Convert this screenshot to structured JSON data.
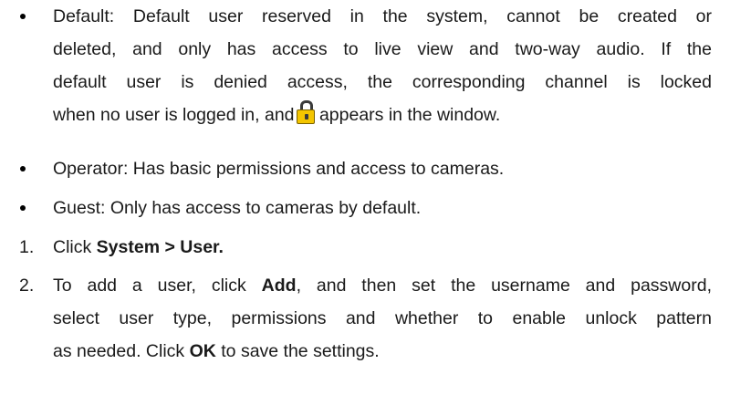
{
  "bullets": [
    {
      "line1": "Default: Default user reserved in the system, cannot be created or",
      "line2": "deleted, and only has access to live view and two-way audio. If the",
      "line3": "default user is denied access, the corresponding channel is locked",
      "line4_before_icon": "when no user is logged in, and",
      "line4_after_icon": " appears in the window.",
      "icon": "lock-icon"
    },
    {
      "text": "Operator: Has basic permissions and access to cameras."
    },
    {
      "text": "Guest: Only has access to cameras by default."
    }
  ],
  "steps": [
    {
      "number": "1.",
      "prefix": "Click ",
      "bold": "System > User."
    },
    {
      "number": "2.",
      "line1_prefix": "To add a user, click ",
      "line1_bold": "Add",
      "line1_suffix": ", and then set the username and password,",
      "line2": "select user type, permissions and whether to enable unlock pattern",
      "line3_prefix": "as needed. Click ",
      "line3_bold": "OK",
      "line3_suffix": " to save the settings."
    }
  ]
}
